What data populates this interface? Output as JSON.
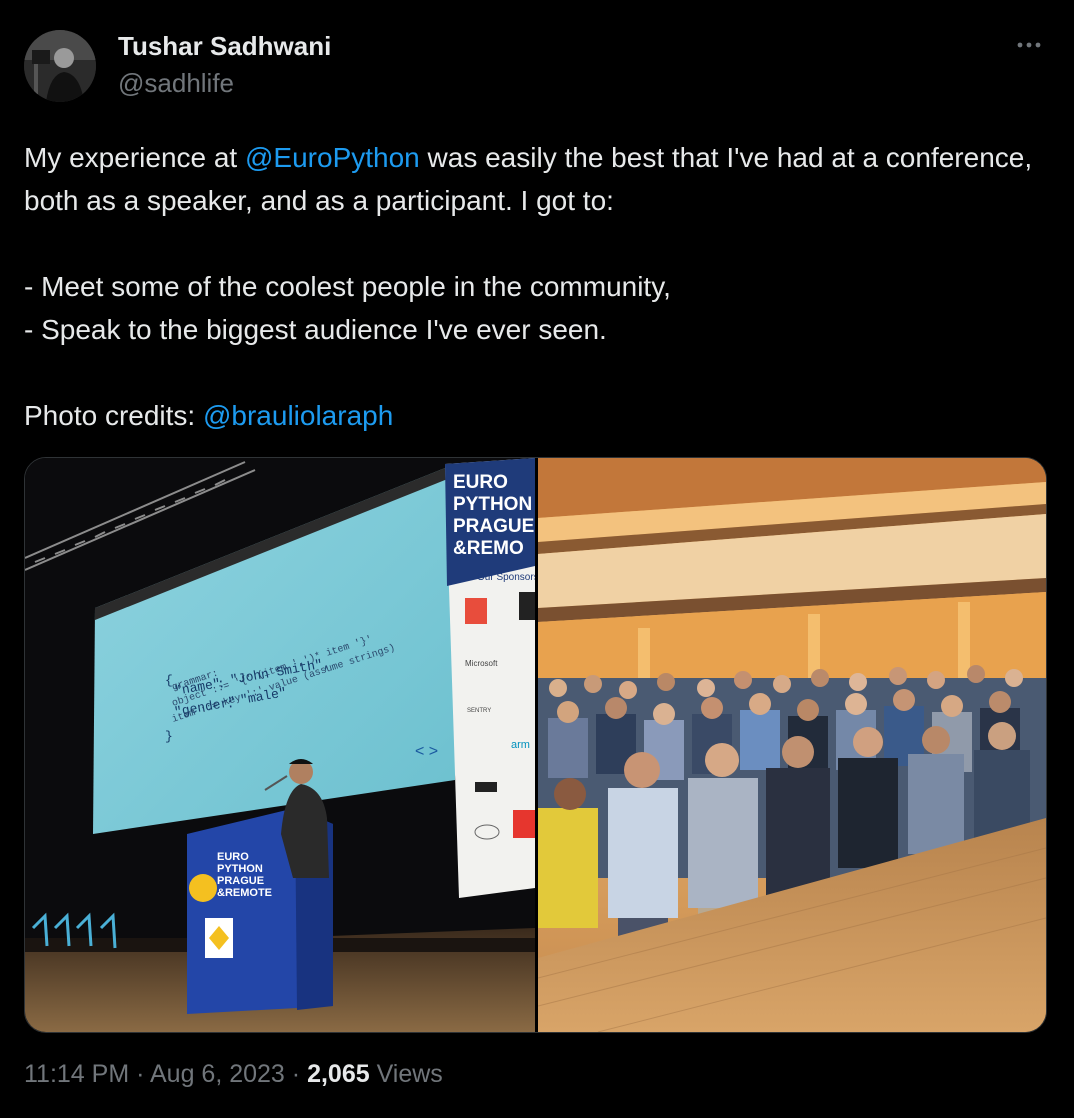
{
  "author": {
    "name": "Tushar Sadhwani",
    "handle": "@sadhlife"
  },
  "more_icon": "more-horizontal-icon",
  "tweet": {
    "line1_before": "My experience at ",
    "mention1": "@EuroPython",
    "line1_after": " was easily the best that I've had at a conference, both as a speaker, and as a participant. I got to:",
    "bullet1": "- Meet some of the coolest people in the community,",
    "bullet2": "- Speak to the biggest audience I've ever seen.",
    "credits_label": "Photo credits: ",
    "mention2": "@brauliolaraph"
  },
  "photo_left": {
    "banner": [
      "EURO",
      "PYTHON",
      "PRAGUE",
      "&REMO"
    ],
    "sponsors_label": "Our Sponsors",
    "sponsor_names": [
      "Microsoft",
      "SENTRY",
      "arm"
    ],
    "slide_code": [
      "{",
      "\"name\"",
      ":",
      "\"John Smith\"",
      ",",
      "\"gender\"",
      ":",
      "\"male\"",
      "}"
    ],
    "podium": [
      "EURO",
      "PYTHON",
      "PRAGUE",
      "&REMOTE"
    ]
  },
  "footer": {
    "time": "11:14 PM",
    "sep1": " · ",
    "date": "Aug 6, 2023",
    "sep2": " · ",
    "views_count": "2,065",
    "views_label": " Views"
  },
  "colors": {
    "link": "#1d9bf0",
    "text": "#e7e9ea",
    "muted": "#71767b",
    "background": "#000000"
  }
}
